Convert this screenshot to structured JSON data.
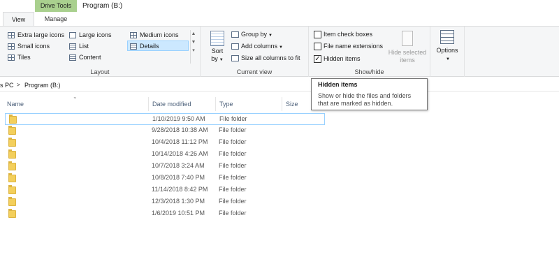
{
  "ribbon_tabs": {
    "context_header": "Drive Tools",
    "window_title": "Program (B:)",
    "view": "View",
    "manage": "Manage"
  },
  "layout_group": {
    "label": "Layout",
    "items": [
      "Extra large icons",
      "Large icons",
      "Medium icons",
      "Small icons",
      "List",
      "Details",
      "Tiles",
      "Content"
    ],
    "selected": "Details"
  },
  "current_view_group": {
    "label": "Current view",
    "sort_by_top": "Sort",
    "sort_by_bottom": "by",
    "group_by": "Group by",
    "add_columns": "Add columns",
    "size_all_columns": "Size all columns to fit"
  },
  "show_hide_group": {
    "label": "Show/hide",
    "item_check_boxes": "Item check boxes",
    "item_check_boxes_checked": false,
    "file_name_extensions": "File name extensions",
    "file_name_extensions_checked": false,
    "hidden_items": "Hidden items",
    "hidden_items_checked": true,
    "hide_selected_top": "Hide selected",
    "hide_selected_bottom": "items"
  },
  "options": {
    "label": "Options"
  },
  "address": {
    "crumb_pc": "s PC",
    "separator": ">",
    "crumb_drive": "Program (B:)"
  },
  "columns": {
    "name": "Name",
    "date_modified": "Date modified",
    "type": "Type",
    "size": "Size"
  },
  "rows": [
    {
      "name": "",
      "date": "1/10/2019 9:50 AM",
      "type": "File folder"
    },
    {
      "name": "",
      "date": "9/28/2018 10:38 AM",
      "type": "File folder"
    },
    {
      "name": "",
      "date": "10/4/2018 11:12 PM",
      "type": "File folder"
    },
    {
      "name": "",
      "date": "10/14/2018 4:26 AM",
      "type": "File folder"
    },
    {
      "name": "",
      "date": "10/7/2018 3:24 AM",
      "type": "File folder"
    },
    {
      "name": "",
      "date": "10/8/2018 7:40 PM",
      "type": "File folder"
    },
    {
      "name": "",
      "date": "11/14/2018 8:42 PM",
      "type": "File folder"
    },
    {
      "name": "",
      "date": "12/3/2018 1:30 PM",
      "type": "File folder"
    },
    {
      "name": "",
      "date": "1/6/2019 10:51 PM",
      "type": "File folder"
    }
  ],
  "tooltip": {
    "title": "Hidden items",
    "body": "Show or hide the files and folders that are marked as hidden."
  },
  "colors": {
    "context_tab": "#a9d08e",
    "selection": "#cce8ff",
    "folder": "#f3cf5c"
  }
}
